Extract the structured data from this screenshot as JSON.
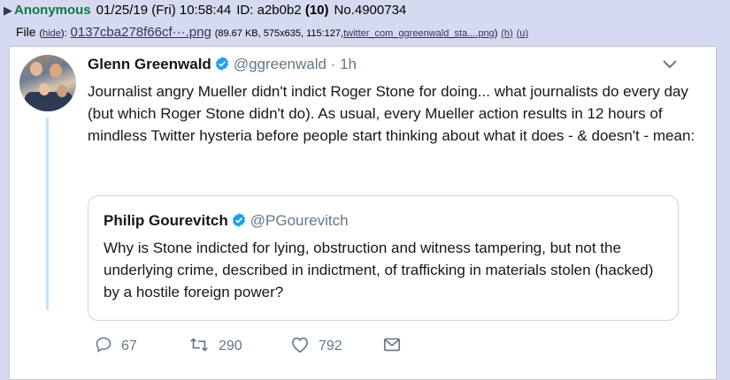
{
  "post": {
    "arrow": "▶",
    "name": "Anonymous",
    "datetime": "01/25/19 (Fri) 10:58:44",
    "id_label": "ID: a2b0b2",
    "id_count": "(10)",
    "number": "No.4900734"
  },
  "file": {
    "label": "File",
    "hide_open": "(",
    "hide_link": "hide",
    "hide_close": "):",
    "filename": "0137cba278f66cf···.png",
    "meta_open": "(89.67 KB, 575x635, 115:127,",
    "original_name": "twitter_com_ggreenwald_sta....png",
    "meta_close": ")",
    "h_link": "(h)",
    "u_link": "(u)"
  },
  "tweet": {
    "name": "Glenn Greenwald",
    "handle": "@ggreenwald · 1h",
    "text": "Journalist angry Mueller didn't indict Roger Stone for doing... what journalists do every day (but which Roger Stone didn't do). As usual, every Mueller action results in 12 hours of mindless Twitter hysteria before people start thinking about what it does - & doesn't - mean:",
    "quote": {
      "name": "Philip Gourevitch",
      "handle": "@PGourevitch",
      "text": "Why is Stone indicted for lying, obstruction and witness tampering, but not the underlying crime, described in indictment, of trafficking in materials stolen (hacked) by a hostile foreign power?"
    },
    "replies": "67",
    "retweets": "290",
    "likes": "792"
  },
  "colors": {
    "board_bg": "#d6daf0",
    "name_green": "#117743",
    "link": "#34345c",
    "twitter_gray": "#657786",
    "verified_blue": "#1da1f2"
  }
}
